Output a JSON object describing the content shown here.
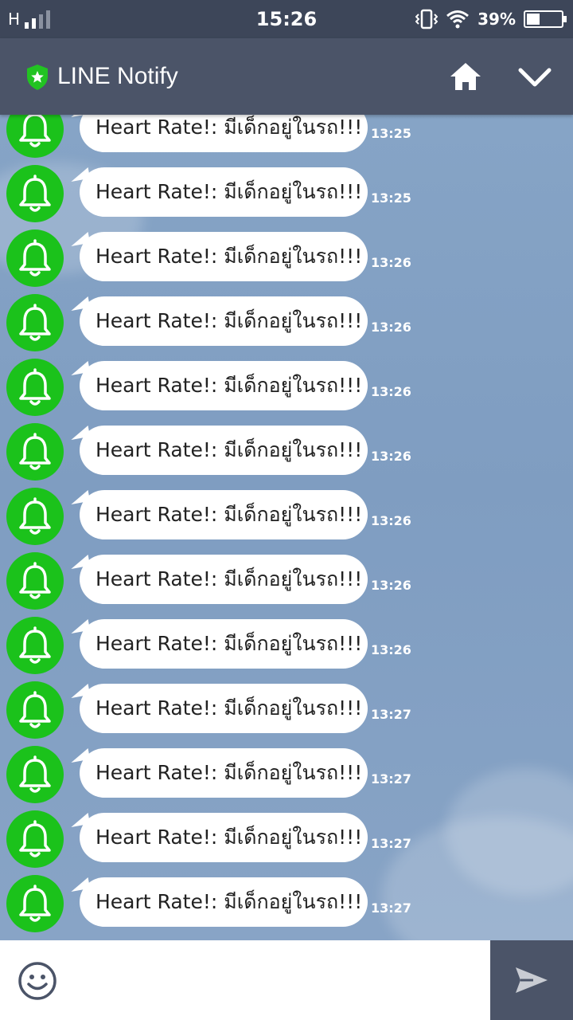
{
  "status_bar": {
    "network": "H",
    "time": "15:26",
    "battery_percent": "39%",
    "battery_level": 0.39
  },
  "header": {
    "title": "LINE Notify",
    "icons": [
      "shield-star-icon",
      "home-icon",
      "chevron-down-icon"
    ]
  },
  "messages": [
    {
      "text": "Heart Rate!: มีเด็กอยู่ในรถ!!!",
      "time": "13:25"
    },
    {
      "text": "Heart Rate!: มีเด็กอยู่ในรถ!!!",
      "time": "13:25"
    },
    {
      "text": "Heart Rate!: มีเด็กอยู่ในรถ!!!",
      "time": "13:26"
    },
    {
      "text": "Heart Rate!: มีเด็กอยู่ในรถ!!!",
      "time": "13:26"
    },
    {
      "text": "Heart Rate!: มีเด็กอยู่ในรถ!!!",
      "time": "13:26"
    },
    {
      "text": "Heart Rate!: มีเด็กอยู่ในรถ!!!",
      "time": "13:26"
    },
    {
      "text": "Heart Rate!: มีเด็กอยู่ในรถ!!!",
      "time": "13:26"
    },
    {
      "text": "Heart Rate!: มีเด็กอยู่ในรถ!!!",
      "time": "13:26"
    },
    {
      "text": "Heart Rate!: มีเด็กอยู่ในรถ!!!",
      "time": "13:26"
    },
    {
      "text": "Heart Rate!: มีเด็กอยู่ในรถ!!!",
      "time": "13:27"
    },
    {
      "text": "Heart Rate!: มีเด็กอยู่ในรถ!!!",
      "time": "13:27"
    },
    {
      "text": "Heart Rate!: มีเด็กอยู่ในรถ!!!",
      "time": "13:27"
    },
    {
      "text": "Heart Rate!: มีเด็กอยู่ในรถ!!!",
      "time": "13:27"
    }
  ],
  "input": {
    "value": "",
    "placeholder": ""
  },
  "colors": {
    "status_bar_bg": "#3d4659",
    "header_bg": "#4b5468",
    "avatar_green": "#1bc21b",
    "chat_bg": "#7f9cc0"
  }
}
